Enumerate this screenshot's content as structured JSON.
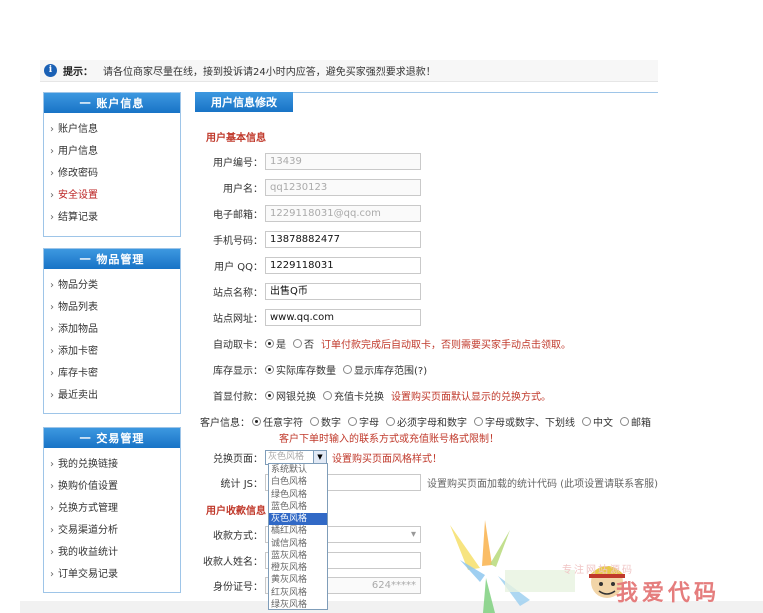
{
  "notice": {
    "label": "提示：",
    "text": "请各位商家尽量在线，接到投诉请24小时内应答，避免买家强烈要求退款！"
  },
  "sidebar": {
    "account": {
      "title": "一 账户信息",
      "items": [
        "账户信息",
        "用户信息",
        "修改密码",
        "安全设置",
        "结算记录"
      ]
    },
    "goods": {
      "title": "一 物品管理",
      "items": [
        "物品分类",
        "物品列表",
        "添加物品",
        "添加卡密",
        "库存卡密",
        "最近卖出"
      ]
    },
    "trade": {
      "title": "一 交易管理",
      "items": [
        "我的兑换链接",
        "换购价值设置",
        "兑换方式管理",
        "交易渠道分析",
        "我的收益统计",
        "订单交易记录"
      ]
    }
  },
  "main": {
    "tab": "用户信息修改",
    "section_basic": "用户基本信息",
    "section_payment": "用户收款信息",
    "fields": {
      "user_id": {
        "label": "用户编号：",
        "value": "13439"
      },
      "username": {
        "label": "用户名：",
        "value": "qq1230123"
      },
      "email": {
        "label": "电子邮箱：",
        "value": "1229118031@qq.com"
      },
      "phone": {
        "label": "手机号码：",
        "value": "13878882477"
      },
      "qq": {
        "label": "用户 QQ：",
        "value": "1229118031"
      },
      "site_name": {
        "label": "站点名称：",
        "value": "出售Q币"
      },
      "site_url": {
        "label": "站点网址：",
        "value": "www.qq.com"
      },
      "auto_card": {
        "label": "自动取卡：",
        "opt_yes": "是",
        "opt_no": "否",
        "note": "订单付款完成后自动取卡，否则需要买家手动点击领取。"
      },
      "stock": {
        "label": "库存显示：",
        "opt1": "实际库存数量",
        "opt2": "显示库存范围(?)"
      },
      "pay_default": {
        "label": "首显付款：",
        "opt1": "网银兑换",
        "opt2": "充值卡兑换",
        "note": "设置购买页面默认显示的兑换方式。"
      },
      "customer_info": {
        "label": "客户信息：",
        "opts": [
          "任意字符",
          "数字",
          "字母",
          "必须字母和数字",
          "字母或数字、下划线",
          "中文",
          "邮箱"
        ],
        "note": "客户下单时输入的联系方式或充值账号格式限制！"
      },
      "page_style": {
        "label": "兑换页面：",
        "value": "灰色风格",
        "note": "设置购买页面风格样式！"
      },
      "stats_js": {
        "label": "统计 JS：",
        "note": "设置购买页面加载的统计代码 (此项设置请联系客服)"
      },
      "pay_method": {
        "label": "收款方式："
      },
      "payee_name": {
        "label": "收款人姓名："
      },
      "id_number": {
        "label": "身份证号：",
        "value": "624*****"
      }
    },
    "style_options": [
      "系统默认",
      "白色风格",
      "绿色风格",
      "蓝色风格",
      "灰色风格",
      "橘红风格",
      "诚信风格",
      "蓝灰风格",
      "橙灰风格",
      "黄灰风格",
      "红灰风格",
      "绿灰风格"
    ],
    "style_selected_index": 4
  },
  "watermark": {
    "line1": "专注网站源码",
    "line2": "我爱代码"
  },
  "colors": {
    "accent_blue": "#1873c6",
    "note_red": "#c0392b"
  }
}
